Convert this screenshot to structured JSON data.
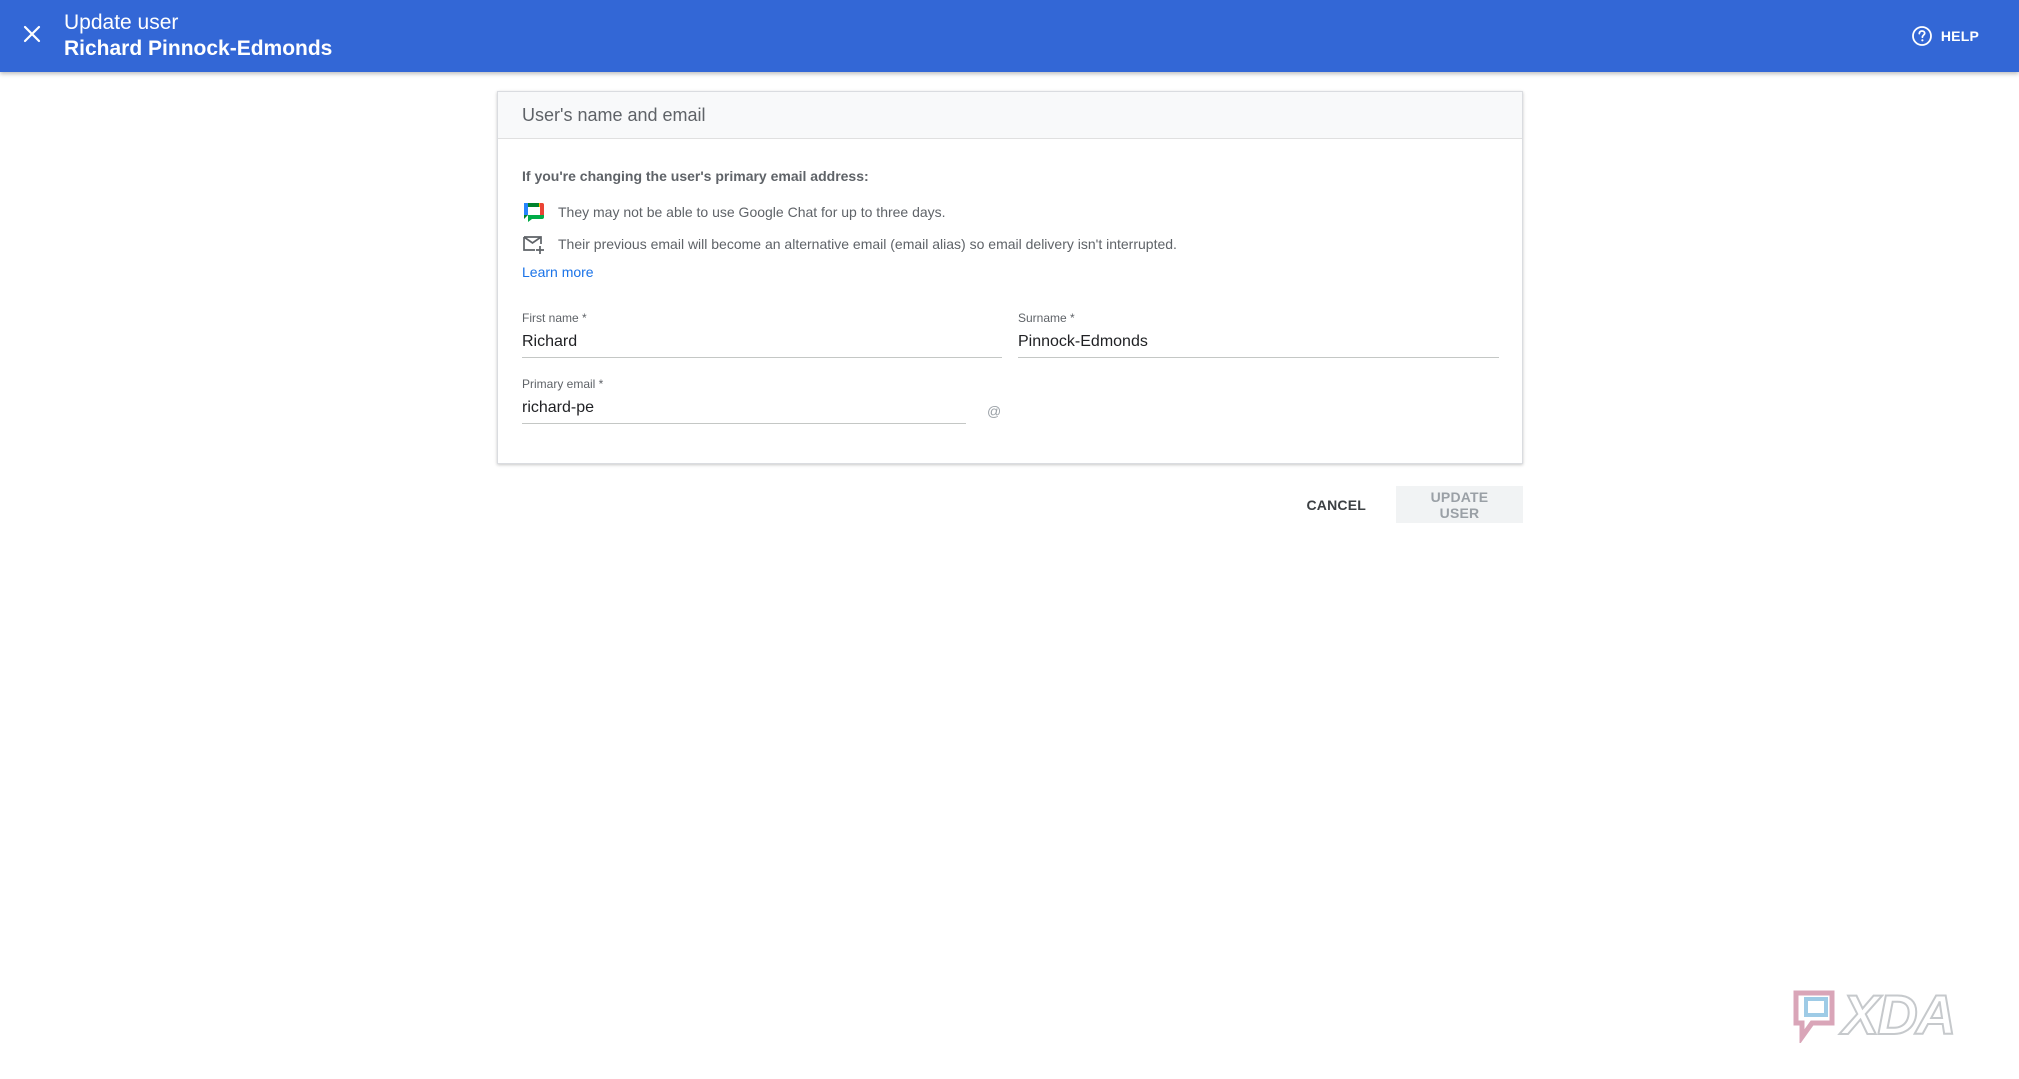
{
  "header": {
    "close_icon": "close-icon",
    "title": "Update user",
    "subtitle": "Richard Pinnock-Edmonds",
    "help_label": "HELP",
    "help_icon": "help-circle-icon",
    "background_color": "#3367d6"
  },
  "card": {
    "title": "User's name and email",
    "notice_heading": "If you're changing the user's primary email address:",
    "notices": [
      {
        "icon": "google-chat-icon",
        "text": "They may not be able to use Google Chat for up to three days."
      },
      {
        "icon": "mail-add-icon",
        "text": "Their previous email will become an alternative email (email alias) so email delivery isn't interrupted."
      }
    ],
    "learn_more": "Learn more",
    "fields": {
      "first_name": {
        "label": "First name *",
        "value": "Richard"
      },
      "surname": {
        "label": "Surname *",
        "value": "Pinnock-Edmonds"
      },
      "primary_email": {
        "label": "Primary email *",
        "value": "richard-pe",
        "suffix": "@"
      }
    }
  },
  "actions": {
    "cancel": "CANCEL",
    "update": "UPDATE USER"
  },
  "watermark": {
    "text": "XDA"
  }
}
